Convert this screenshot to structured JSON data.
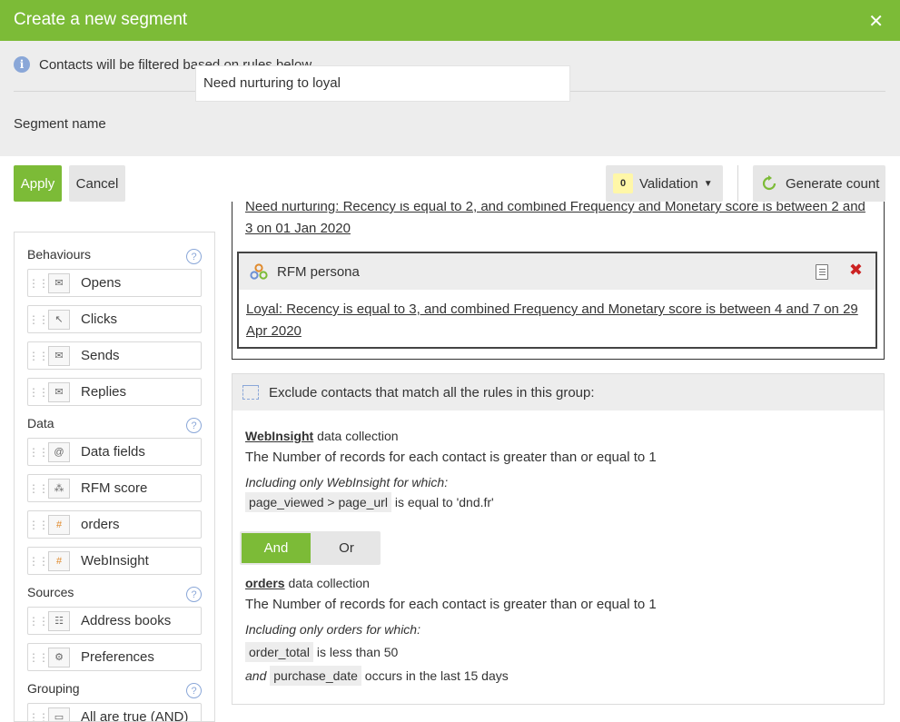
{
  "dialog": {
    "title": "Create a new segment",
    "close_glyph": "✕"
  },
  "info": {
    "text": "Contacts will be filtered based on rules below",
    "icon": "info-icon"
  },
  "segment_name": {
    "label": "Segment name",
    "value": "Need nurturing to loyal"
  },
  "toolbar": {
    "apply": "Apply",
    "cancel": "Cancel",
    "validation_count": "0",
    "validation_label": "Validation",
    "generate_count": "Generate count"
  },
  "sidebar": {
    "behaviours": {
      "title": "Behaviours",
      "items": [
        "Opens",
        "Clicks",
        "Sends",
        "Replies"
      ]
    },
    "data": {
      "title": "Data",
      "items": [
        "Data fields",
        "RFM score",
        "orders",
        "WebInsight"
      ]
    },
    "sources": {
      "title": "Sources",
      "items": [
        "Address books",
        "Preferences"
      ]
    },
    "grouping": {
      "title": "Grouping",
      "items": [
        "All are true (AND)"
      ]
    }
  },
  "rules": {
    "clipped_rule": "Need nurturing: Recency is equal to 2, and combined Frequency and Monetary score is between 2 and 3 on 01 Jan 2020",
    "rfm_title": "RFM persona",
    "rfm_rule": "Loyal: Recency is equal to 3, and combined Frequency and Monetary score is between 4 and 7 on 29 Apr 2020"
  },
  "exclude_group": {
    "title": "Exclude contacts that match all the rules in this group:",
    "webinsight": {
      "collection": "WebInsight",
      "collection_suffix": "data collection",
      "count_rule": "The Number of records for each contact is greater than or equal to 1",
      "including": "Including only WebInsight for which:",
      "field": "page_viewed > page_url",
      "condition": "is equal to 'dnd.fr'"
    },
    "operator": {
      "and": "And",
      "or": "Or",
      "selected": "And"
    },
    "orders": {
      "collection": "orders",
      "collection_suffix": "data collection",
      "count_rule": "The Number of records for each contact is greater than or equal to 1",
      "including": "Including only orders for which:",
      "field1": "order_total",
      "condition1": "is less than 50",
      "joiner": "and",
      "field2": "purchase_date",
      "condition2": "occurs in the last 15 days"
    }
  },
  "colors": {
    "brand_green": "#7cbb37",
    "delete_red": "#cc2222",
    "info_blue": "#8aa7d8"
  }
}
